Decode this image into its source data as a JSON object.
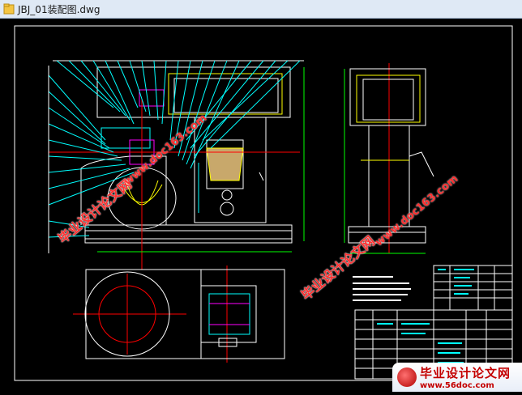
{
  "window": {
    "title": "JBJ_01装配图.dwg",
    "file_icon": "dwg-file-icon"
  },
  "drawing": {
    "watermark_cn": "毕业设计论文网",
    "watermark_url": "www.doc163.com",
    "logo_text": "毕业设计论文网",
    "logo_url": "www.56doc.com",
    "colors": {
      "background": "#000000",
      "white": "#ffffff",
      "cyan": "#00ffff",
      "yellow": "#ffff00",
      "red": "#ff0000",
      "magenta": "#ff00ff",
      "green": "#00ff00",
      "border": "#ffffff"
    }
  }
}
